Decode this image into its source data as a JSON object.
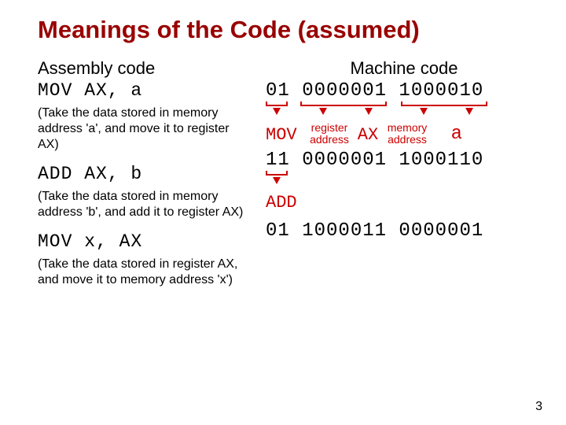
{
  "title": "Meanings of the Code (assumed)",
  "left_header": "Assembly code",
  "right_header": "Machine code",
  "instr": [
    {
      "asm": "MOV AX, a",
      "desc": "(Take the data stored in memory address 'a', and move it to register AX)",
      "mc": "01 0000001 1000010"
    },
    {
      "asm": "ADD AX, b",
      "desc": "(Take the data stored in memory address 'b', and add it to register AX)",
      "mc": "11 0000001 1000110"
    },
    {
      "asm": "MOV x, AX",
      "desc": "(Take the data stored in register AX, and move it to memory address 'x')",
      "mc": "01 1000011 0000001"
    }
  ],
  "annot": {
    "op": "MOV",
    "reg_addr_top": "register",
    "reg_addr_bot": "address",
    "ax": "AX",
    "mem_addr_top": "memory",
    "mem_addr_bot": "address",
    "a": "a",
    "add": "ADD"
  },
  "page_number": "3"
}
